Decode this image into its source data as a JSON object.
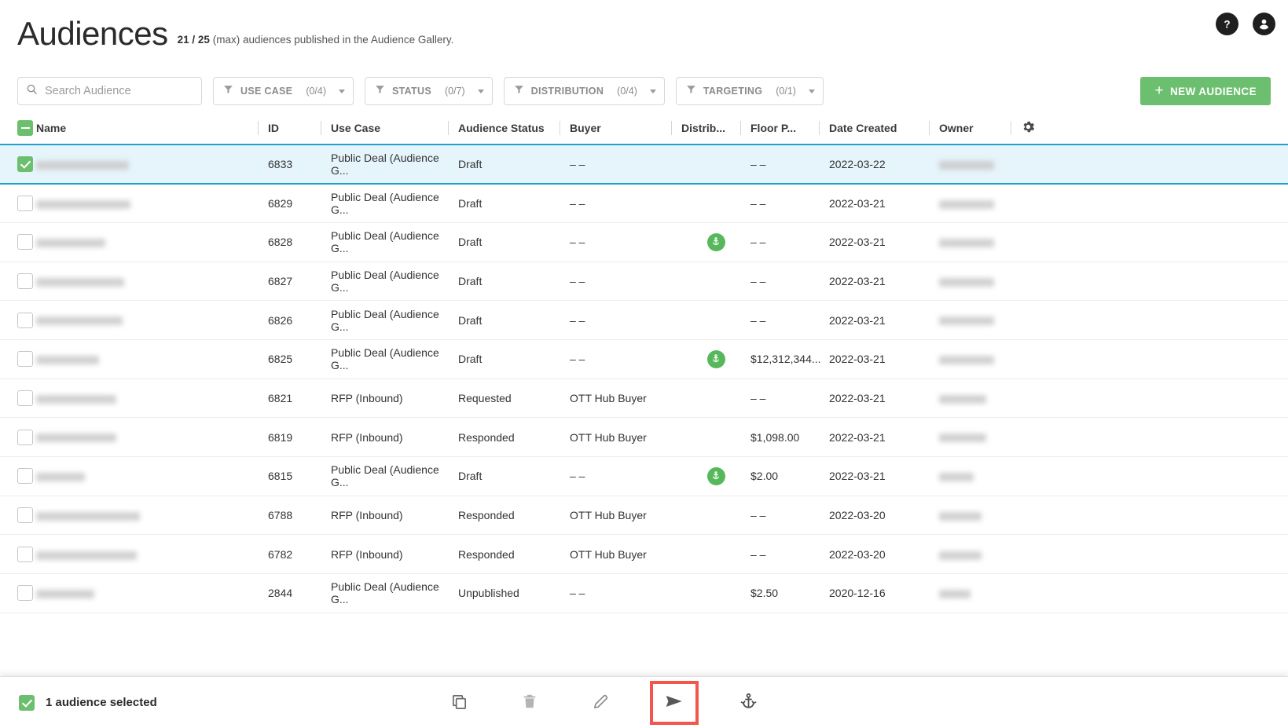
{
  "header": {
    "title": "Audiences",
    "count": "21 / 25",
    "subtitle": "(max) audiences published in the Audience Gallery.",
    "help_icon": "help-circle-icon",
    "account_icon": "account-circle-icon"
  },
  "toolbar": {
    "search": {
      "placeholder": "Search Audience",
      "value": "",
      "icon": "search-icon"
    },
    "filters": [
      {
        "label": "USE CASE",
        "count": "(0/4)",
        "icon": "filter-funnel-icon"
      },
      {
        "label": "STATUS",
        "count": "(0/7)",
        "icon": "filter-funnel-icon"
      },
      {
        "label": "DISTRIBUTION",
        "count": "(0/4)",
        "icon": "filter-funnel-icon"
      },
      {
        "label": "TARGETING",
        "count": "(0/1)",
        "icon": "filter-funnel-icon"
      }
    ],
    "new_audience_label": "NEW AUDIENCE",
    "new_audience_plus": "+",
    "accent_green": "#6cbf6e"
  },
  "table": {
    "settings_icon": "gear-icon",
    "header_checkbox_state": "indeterminate",
    "columns": [
      "Name",
      "ID",
      "Use Case",
      "Audience Status",
      "Buyer",
      "Distrib...",
      "Floor P...",
      "Date Created",
      "Owner"
    ],
    "rows": [
      {
        "selected": true,
        "name_redacted_width": 118,
        "id": "6833",
        "use_case": "Public Deal (Audience G...",
        "status": "Draft",
        "buyer": "– –",
        "distribution": "",
        "floor_price": "– –",
        "date": "2022-03-22",
        "owner_redacted_width": 70
      },
      {
        "selected": false,
        "name_redacted_width": 120,
        "id": "6829",
        "use_case": "Public Deal (Audience G...",
        "status": "Draft",
        "buyer": "– –",
        "distribution": "",
        "floor_price": "– –",
        "date": "2022-03-21",
        "owner_redacted_width": 70
      },
      {
        "selected": false,
        "name_redacted_width": 88,
        "id": "6828",
        "use_case": "Public Deal (Audience G...",
        "status": "Draft",
        "buyer": "– –",
        "distribution": "anchor-icon",
        "floor_price": "– –",
        "date": "2022-03-21",
        "owner_redacted_width": 70
      },
      {
        "selected": false,
        "name_redacted_width": 112,
        "id": "6827",
        "use_case": "Public Deal (Audience G...",
        "status": "Draft",
        "buyer": "– –",
        "distribution": "",
        "floor_price": "– –",
        "date": "2022-03-21",
        "owner_redacted_width": 70
      },
      {
        "selected": false,
        "name_redacted_width": 110,
        "id": "6826",
        "use_case": "Public Deal (Audience G...",
        "status": "Draft",
        "buyer": "– –",
        "distribution": "",
        "floor_price": "– –",
        "date": "2022-03-21",
        "owner_redacted_width": 70
      },
      {
        "selected": false,
        "name_redacted_width": 80,
        "id": "6825",
        "use_case": "Public Deal (Audience G...",
        "status": "Draft",
        "buyer": "– –",
        "distribution": "anchor-icon",
        "floor_price": "$12,312,344...",
        "date": "2022-03-21",
        "owner_redacted_width": 70
      },
      {
        "selected": false,
        "name_redacted_width": 102,
        "id": "6821",
        "use_case": "RFP (Inbound)",
        "status": "Requested",
        "buyer": "OTT Hub Buyer",
        "distribution": "",
        "floor_price": "– –",
        "date": "2022-03-21",
        "owner_redacted_width": 60
      },
      {
        "selected": false,
        "name_redacted_width": 102,
        "id": "6819",
        "use_case": "RFP (Inbound)",
        "status": "Responded",
        "buyer": "OTT Hub Buyer",
        "distribution": "",
        "floor_price": "$1,098.00",
        "date": "2022-03-21",
        "owner_redacted_width": 60
      },
      {
        "selected": false,
        "name_redacted_width": 62,
        "id": "6815",
        "use_case": "Public Deal (Audience G...",
        "status": "Draft",
        "buyer": "– –",
        "distribution": "anchor-icon",
        "floor_price": "$2.00",
        "date": "2022-03-21",
        "owner_redacted_width": 44
      },
      {
        "selected": false,
        "name_redacted_width": 132,
        "id": "6788",
        "use_case": "RFP (Inbound)",
        "status": "Responded",
        "buyer": "OTT Hub Buyer",
        "distribution": "",
        "floor_price": "– –",
        "date": "2022-03-20",
        "owner_redacted_width": 54
      },
      {
        "selected": false,
        "name_redacted_width": 128,
        "id": "6782",
        "use_case": "RFP (Inbound)",
        "status": "Responded",
        "buyer": "OTT Hub Buyer",
        "distribution": "",
        "floor_price": "– –",
        "date": "2022-03-20",
        "owner_redacted_width": 54
      },
      {
        "selected": false,
        "name_redacted_width": 74,
        "id": "2844",
        "use_case": "Public Deal (Audience G...",
        "status": "Unpublished",
        "buyer": "– –",
        "distribution": "",
        "floor_price": "$2.50",
        "date": "2020-12-16",
        "owner_redacted_width": 40
      }
    ]
  },
  "action_bar": {
    "selection_label": "1 audience selected",
    "selection_checkbox_state": "checked",
    "actions": [
      {
        "icon": "copy-icon",
        "highlighted": false
      },
      {
        "icon": "trash-icon",
        "highlighted": false
      },
      {
        "icon": "pencil-icon",
        "highlighted": false
      },
      {
        "icon": "send-icon",
        "highlighted": true
      },
      {
        "icon": "anchor-move-icon",
        "highlighted": false
      }
    ],
    "highlight_color": "#f2564c"
  }
}
